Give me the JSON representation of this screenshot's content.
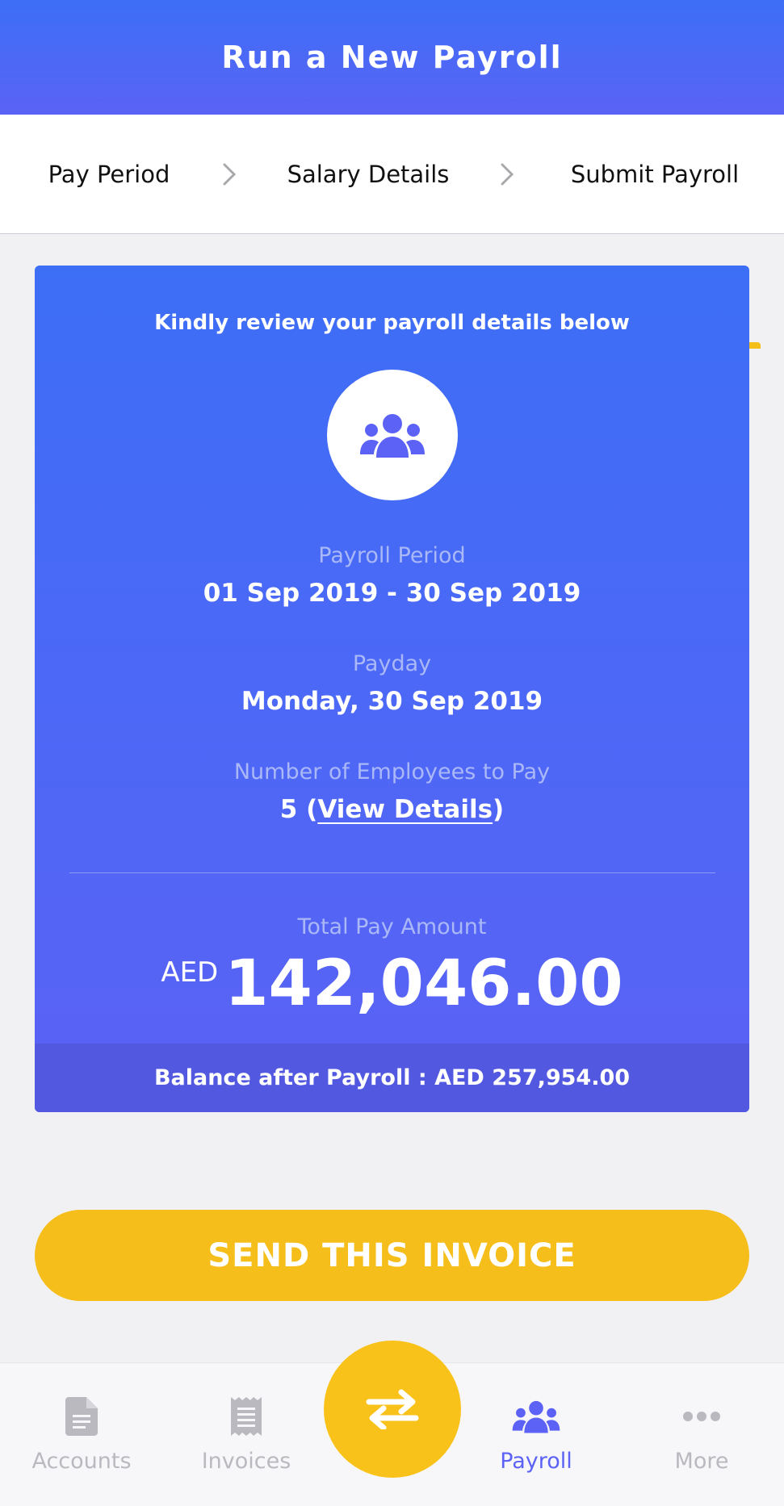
{
  "header": {
    "title": "Run a New Payroll"
  },
  "steps": [
    {
      "label": "Pay Period"
    },
    {
      "label": "Salary Details"
    },
    {
      "label": "Submit Payroll"
    }
  ],
  "active_step": "Submit Payroll",
  "card": {
    "review_text": "Kindly review your payroll details below",
    "payroll_period_label": "Payroll Period",
    "payroll_period_value": "01 Sep 2019 - 30 Sep 2019",
    "payday_label": "Payday",
    "payday_value": "Monday, 30 Sep 2019",
    "employees_label": "Number of Employees to Pay",
    "employees_count": "5",
    "employees_open": " (",
    "view_details": "View Details",
    "employees_close": ")",
    "total_label": "Total Pay Amount",
    "currency": "AED",
    "total_amount": "142,046.00",
    "balance_text": "Balance after Payroll : AED 257,954.00"
  },
  "send_button": {
    "label": "SEND THIS INVOICE"
  },
  "bottom_nav": {
    "items": [
      {
        "label": "Accounts",
        "icon": "document-icon"
      },
      {
        "label": "Invoices",
        "icon": "receipt-icon"
      },
      {
        "label": "Payroll",
        "icon": "users-icon"
      },
      {
        "label": "More",
        "icon": "more-dots-icon"
      }
    ],
    "active": "Payroll",
    "center_icon": "transfer-arrows-icon"
  },
  "colors": {
    "primary_blue": "#3d6ff6",
    "primary_purple": "#5b62f5",
    "accent_yellow": "#f5be1a",
    "inactive_gray": "#b9b9bf"
  }
}
